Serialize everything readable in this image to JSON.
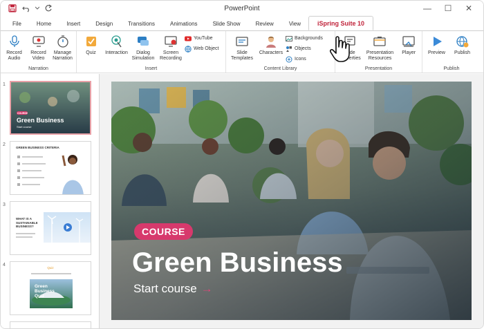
{
  "app": {
    "title": "PowerPoint"
  },
  "quick_access": {
    "save_icon": "save-icon",
    "undo_icon": "undo-icon",
    "redo_icon": "redo-icon"
  },
  "window_controls": {
    "minimize": "—",
    "maximize": "☐",
    "close": "✕"
  },
  "tabs": [
    "File",
    "Home",
    "Insert",
    "Design",
    "Transitions",
    "Animations",
    "Slide Show",
    "Review",
    "View",
    "iSpring Suite 10"
  ],
  "active_tab": "iSpring Suite 10",
  "ribbon": {
    "narration": {
      "label": "Narration",
      "buttons": [
        "Record Audio",
        "Record Video",
        "Manage Narration"
      ]
    },
    "insert": {
      "label": "Insert",
      "buttons": [
        "Quiz",
        "Interaction",
        "Dialog Simulation",
        "Screen Recording"
      ],
      "small": [
        "YouTube",
        "Web Object"
      ]
    },
    "content_library": {
      "label": "Content Library",
      "buttons": [
        "Slide Templates",
        "Characters"
      ],
      "small": [
        "Backgrounds",
        "Objects",
        "Icons"
      ]
    },
    "presentation": {
      "label": "Presentation",
      "buttons": [
        "Slide Properties",
        "Presentation Resources",
        "Player"
      ]
    },
    "publish": {
      "label": "Publish",
      "buttons": [
        "Preview",
        "Publish"
      ]
    }
  },
  "thumbnails": [
    {
      "num": "1",
      "title": "Green Business",
      "subtitle": "Start course",
      "badge": "COURSE"
    },
    {
      "num": "2",
      "title": "GREEN BUSINESS CRITERIA"
    },
    {
      "num": "3",
      "title": "WHAT IS A SUSTAINABLE BUSINESS?"
    },
    {
      "num": "4",
      "title": "Green Business Quiz",
      "kicker": "Quiz"
    }
  ],
  "slide": {
    "badge": "COURSE",
    "title": "Green Business",
    "start": "Start course",
    "arrow": "→"
  },
  "colors": {
    "accent": "#c0233a",
    "badge": "#d7396c",
    "slide_overlay": "#2e3d46"
  }
}
